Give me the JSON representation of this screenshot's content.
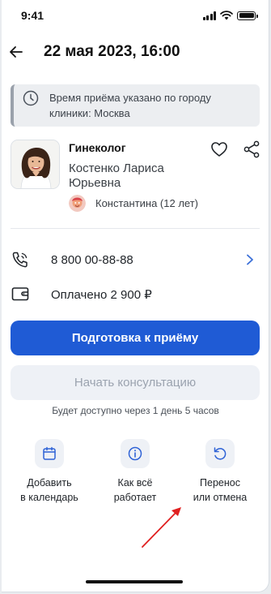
{
  "status_bar": {
    "time": "9:41"
  },
  "header": {
    "title": "22 мая 2023, 16:00"
  },
  "notice": {
    "text": "Время приёма указано по городу клиники: Москва",
    "icon": "clock-icon"
  },
  "doctor": {
    "specialty": "Гинеколог",
    "name": "Костенко Лариса Юрьевна",
    "patient": "Константина (12 лет)"
  },
  "contact": {
    "phone": "8 800 00-88-88"
  },
  "payment": {
    "status": "Оплачено 2 900 ₽"
  },
  "buttons": {
    "prepare": "Подготовка к приёму",
    "start_consultation": "Начать консультацию",
    "availability_note": "Будет доступно через 1 день 5 часов"
  },
  "actions": [
    {
      "icon": "calendar-icon",
      "label_line1": "Добавить",
      "label_line2": "в календарь"
    },
    {
      "icon": "info-icon",
      "label_line1": "Как всё",
      "label_line2": "работает"
    },
    {
      "icon": "reschedule-icon",
      "label_line1": "Перенос",
      "label_line2": "или отмена"
    }
  ],
  "colors": {
    "primary": "#1f5bd5",
    "disabled_bg": "#eef1f6",
    "annotation_arrow": "#e02020"
  }
}
